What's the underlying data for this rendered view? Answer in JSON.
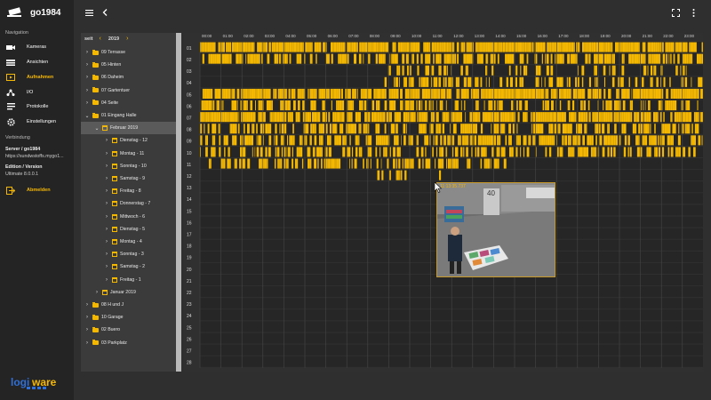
{
  "app": {
    "title": "go1984"
  },
  "colors": {
    "accent": "#f5b800",
    "sidebar_bg": "#242424",
    "page_bg": "#2f2f2f",
    "track_bg": "#262626"
  },
  "sidebar": {
    "nav_title": "Navigation",
    "items": [
      {
        "label": "Kameras",
        "icon": "camera-icon",
        "active": false
      },
      {
        "label": "Ansichten",
        "icon": "views-icon",
        "active": false
      },
      {
        "label": "Aufnahmen",
        "icon": "recordings-icon",
        "active": true
      },
      {
        "label": "I/O",
        "icon": "io-icon",
        "active": false
      },
      {
        "label": "Protokolle",
        "icon": "protocol-icon",
        "active": false
      },
      {
        "label": "Einstellungen",
        "icon": "gear-icon",
        "active": false
      }
    ],
    "connection_title": "Verbindung",
    "server_label": "Server / go1984",
    "server_url": "https://sundwstoffs.mygo1...",
    "edition_label": "Edition / Version",
    "edition_value": "Ultimate  8.0.0.1",
    "logout_label": "Abmelden",
    "footer_logo": "logiware"
  },
  "tree": {
    "unit": "seit",
    "year": "2019",
    "rows": [
      {
        "label": "09 Terrasse",
        "type": "folder",
        "expanded": false,
        "level": 0
      },
      {
        "label": "05 Hinten",
        "type": "folder",
        "expanded": false,
        "level": 0
      },
      {
        "label": "06 Daheim",
        "type": "folder",
        "expanded": false,
        "level": 0
      },
      {
        "label": "07 Gartentuer",
        "type": "folder",
        "expanded": false,
        "level": 0
      },
      {
        "label": "04 Seite",
        "type": "folder",
        "expanded": false,
        "level": 0
      },
      {
        "label": "01 Eingang Halle",
        "type": "folder",
        "expanded": true,
        "level": 0
      },
      {
        "label": "Februar 2019",
        "type": "calendar",
        "expanded": true,
        "level": 1,
        "selected": true
      },
      {
        "label": "Dienstag - 12",
        "type": "calendar",
        "expanded": false,
        "level": 2
      },
      {
        "label": "Montag - 11",
        "type": "calendar",
        "expanded": false,
        "level": 2
      },
      {
        "label": "Sonntag - 10",
        "type": "calendar",
        "expanded": false,
        "level": 2
      },
      {
        "label": "Samstag - 9",
        "type": "calendar",
        "expanded": false,
        "level": 2
      },
      {
        "label": "Freitag - 8",
        "type": "calendar",
        "expanded": false,
        "level": 2
      },
      {
        "label": "Donnerstag - 7",
        "type": "calendar",
        "expanded": false,
        "level": 2
      },
      {
        "label": "Mittwoch - 6",
        "type": "calendar",
        "expanded": false,
        "level": 2
      },
      {
        "label": "Dienstag - 5",
        "type": "calendar",
        "expanded": false,
        "level": 2
      },
      {
        "label": "Montag - 4",
        "type": "calendar",
        "expanded": false,
        "level": 2
      },
      {
        "label": "Sonntag - 3",
        "type": "calendar",
        "expanded": false,
        "level": 2
      },
      {
        "label": "Samstag - 2",
        "type": "calendar",
        "expanded": false,
        "level": 2
      },
      {
        "label": "Freitag - 1",
        "type": "calendar",
        "expanded": false,
        "level": 2
      },
      {
        "label": "Januar 2019",
        "type": "calendar",
        "expanded": false,
        "level": 1
      },
      {
        "label": "08 H und J",
        "type": "folder",
        "expanded": false,
        "level": 0
      },
      {
        "label": "10 Garage",
        "type": "folder",
        "expanded": false,
        "level": 0
      },
      {
        "label": "02 Buero",
        "type": "folder",
        "expanded": false,
        "level": 0
      },
      {
        "label": "03 Parkplatz",
        "type": "folder",
        "expanded": false,
        "level": 0
      }
    ]
  },
  "timeline": {
    "hours": [
      "00:00",
      "01:00",
      "02:00",
      "03:00",
      "04:00",
      "05:00",
      "06:00",
      "07:00",
      "08:00",
      "09:00",
      "10:00",
      "11:00",
      "12:00",
      "13:00",
      "14:00",
      "15:00",
      "16:00",
      "17:00",
      "18:00",
      "19:00",
      "20:00",
      "21:00",
      "22:00",
      "23:00"
    ],
    "days": [
      "01",
      "02",
      "03",
      "04",
      "05",
      "06",
      "07",
      "08",
      "09",
      "10",
      "11",
      "12",
      "13",
      "14",
      "15",
      "16",
      "17",
      "18",
      "19",
      "20",
      "21",
      "22",
      "23",
      "24",
      "25",
      "26",
      "27",
      "28"
    ],
    "recordings": [
      {
        "day": "01",
        "start_hour": 0.0,
        "end_hour": 24.0,
        "density": 0.9
      },
      {
        "day": "02",
        "start_hour": 0.0,
        "end_hour": 24.0,
        "density": 0.55
      },
      {
        "day": "03",
        "start_hour": 8.7,
        "end_hour": 24.0,
        "density": 0.25
      },
      {
        "day": "04",
        "start_hour": 8.7,
        "end_hour": 24.0,
        "density": 0.4
      },
      {
        "day": "05",
        "start_hour": 0.0,
        "end_hour": 24.0,
        "density": 0.85
      },
      {
        "day": "06",
        "start_hour": 0.0,
        "end_hour": 24.0,
        "density": 0.5
      },
      {
        "day": "07",
        "start_hour": 0.0,
        "end_hour": 24.0,
        "density": 0.8
      },
      {
        "day": "08",
        "start_hour": 0.0,
        "end_hour": 24.0,
        "density": 0.5
      },
      {
        "day": "09",
        "start_hour": 0.0,
        "end_hour": 24.0,
        "density": 0.6
      },
      {
        "day": "10",
        "start_hour": 0.0,
        "end_hour": 24.0,
        "density": 0.45
      },
      {
        "day": "11",
        "start_hour": 0.3,
        "end_hour": 14.8,
        "density": 0.5
      },
      {
        "day": "12",
        "start_hour": 7.8,
        "end_hour": 11.6,
        "density": 0.3
      }
    ]
  },
  "preview": {
    "timestamp": "11:13:35.737"
  }
}
